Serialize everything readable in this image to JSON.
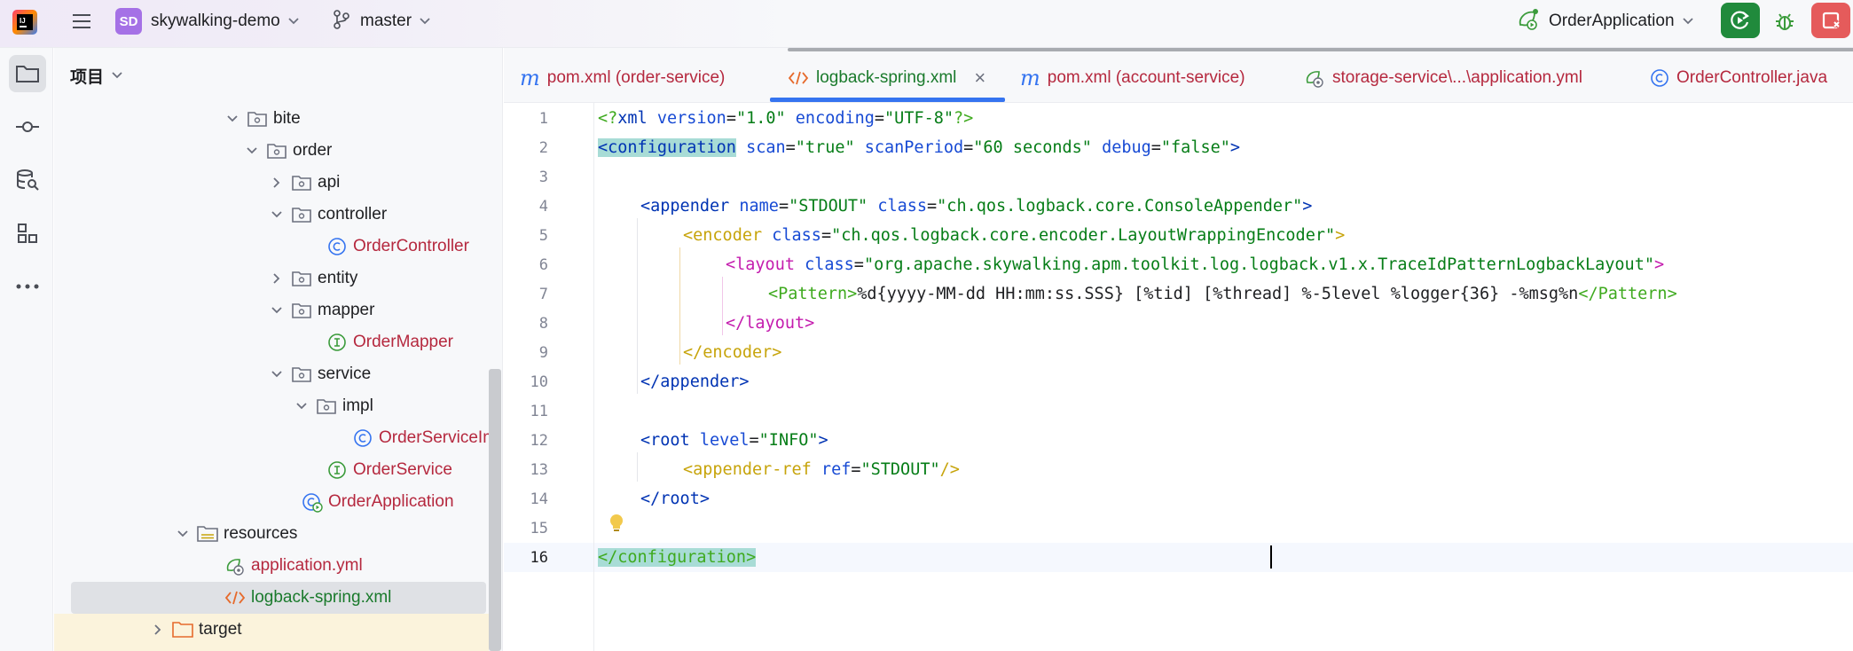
{
  "titlebar": {
    "project_badge": "SD",
    "project_name": "skywalking-demo",
    "branch": "master",
    "run_config": "OrderApplication",
    "colors": {
      "run": "#208a3c",
      "stop": "#e55b5b",
      "badge": "#a571e6"
    }
  },
  "toolstrip": {
    "items": [
      "folder-icon",
      "commit-icon",
      "database-search-icon",
      "structure-icon",
      "more-icon"
    ]
  },
  "project_panel": {
    "title": "项目",
    "tree": [
      {
        "label": "bite",
        "kind": "package",
        "expanded": true
      },
      {
        "label": "order",
        "kind": "package",
        "expanded": true
      },
      {
        "label": "api",
        "kind": "package",
        "expanded": false
      },
      {
        "label": "controller",
        "kind": "package",
        "expanded": true
      },
      {
        "label": "OrderController",
        "kind": "class"
      },
      {
        "label": "entity",
        "kind": "package",
        "expanded": false
      },
      {
        "label": "mapper",
        "kind": "package",
        "expanded": true
      },
      {
        "label": "OrderMapper",
        "kind": "interface"
      },
      {
        "label": "service",
        "kind": "package",
        "expanded": true
      },
      {
        "label": "impl",
        "kind": "package",
        "expanded": true
      },
      {
        "label": "OrderServiceImpl",
        "kind": "class"
      },
      {
        "label": "OrderService",
        "kind": "interface"
      },
      {
        "label": "OrderApplication",
        "kind": "spring-app"
      },
      {
        "label": "resources",
        "kind": "resources-folder",
        "expanded": true
      },
      {
        "label": "application.yml",
        "kind": "yml"
      },
      {
        "label": "logback-spring.xml",
        "kind": "xml",
        "selected": true
      },
      {
        "label": "target",
        "kind": "folder",
        "expanded": false
      }
    ]
  },
  "tabs": [
    {
      "label": "pom.xml (order-service)",
      "icon": "maven-icon"
    },
    {
      "label": "logback-spring.xml",
      "icon": "xml-icon",
      "active": true
    },
    {
      "label": "pom.xml (account-service)",
      "icon": "maven-icon"
    },
    {
      "label": "storage-service\\...\\application.yml",
      "icon": "spring-yml-icon"
    },
    {
      "label": "OrderController.java",
      "icon": "class-icon"
    }
  ],
  "editor": {
    "line_numbers": [
      "1",
      "2",
      "3",
      "4",
      "5",
      "6",
      "7",
      "8",
      "9",
      "10",
      "11",
      "12",
      "13",
      "14",
      "15",
      "16"
    ],
    "current_line": "16",
    "code": {
      "l1": {
        "a": "<?",
        "b": "xml",
        "c": " version",
        "d": "=",
        "e": "\"1.0\"",
        "f": " encoding",
        "g": "=",
        "h": "\"UTF-8\"",
        "i": "?>"
      },
      "l2": {
        "a": "<configuration",
        "b": " scan",
        "c": "=",
        "d": "\"true\"",
        "e": " scanPeriod",
        "f": "=",
        "g": "\"60 seconds\"",
        "h": " debug",
        "i": "=",
        "j": "\"false\"",
        "k": ">"
      },
      "l4": {
        "a": "<appender",
        "b": " name",
        "c": "=",
        "d": "\"STDOUT\"",
        "e": " class",
        "f": "=",
        "g": "\"ch.qos.logback.core.ConsoleAppender\"",
        "h": ">"
      },
      "l5": {
        "a": "<encoder",
        "b": " class",
        "c": "=",
        "d": "\"ch.qos.logback.core.encoder.LayoutWrappingEncoder\"",
        "e": ">"
      },
      "l6": {
        "a": "<layout",
        "b": " class",
        "c": "=",
        "d": "\"org.apache.skywalking.apm.toolkit.log.logback.v1.x.TraceIdPatternLogbackLayout\"",
        "e": ">"
      },
      "l7": {
        "a": "<Pattern>",
        "b": "%d{yyyy-MM-dd HH:mm:ss.SSS} [%tid] [%thread] %-5level %logger{36} -%msg%n",
        "c": "</Pattern>"
      },
      "l8": {
        "a": "</layout>"
      },
      "l9": {
        "a": "</encoder>"
      },
      "l10": {
        "a": "</appender>"
      },
      "l12": {
        "a": "<root",
        "b": " level",
        "c": "=",
        "d": "\"INFO\"",
        "e": ">"
      },
      "l13": {
        "a": "<appender-ref",
        "b": " ref",
        "c": "=",
        "d": "\"STDOUT\"",
        "e": "/>"
      },
      "l14": {
        "a": "</root>"
      },
      "l16": {
        "a": "</configuration",
        "b": ">"
      }
    }
  }
}
